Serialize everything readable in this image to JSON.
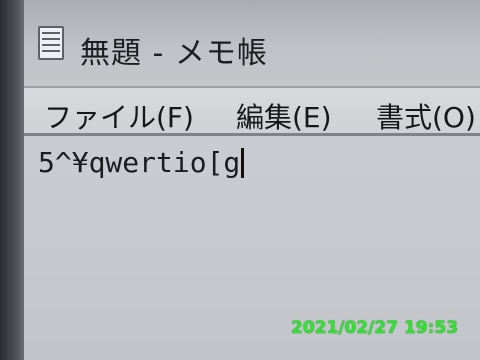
{
  "window": {
    "title": "無題 - メモ帳",
    "icon": "notepad-icon"
  },
  "menu": {
    "items": [
      {
        "label": "ファイル(F)"
      },
      {
        "label": "編集(E)"
      },
      {
        "label": "書式(O)"
      }
    ]
  },
  "editor": {
    "content": "5^¥qwertio[g"
  },
  "photo": {
    "timestamp": "2021/02/27 19:53"
  },
  "colors": {
    "timestamp": "#2fe62f"
  }
}
